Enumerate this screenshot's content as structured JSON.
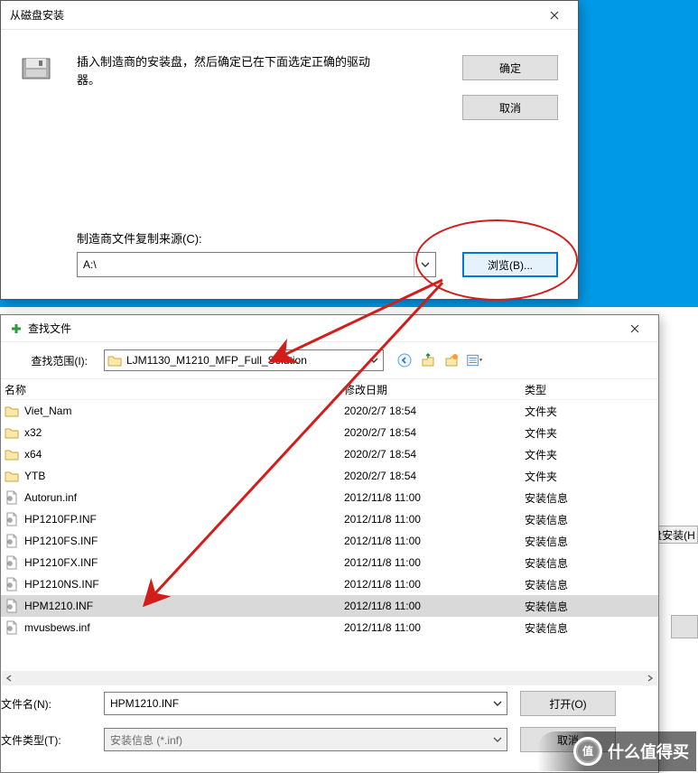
{
  "bg_cut": {
    "text": "盘安装(H"
  },
  "dialog1": {
    "title": "从磁盘安装",
    "instruction": "插入制造商的安装盘，然后确定已在下面选定正确的驱动器。",
    "ok": "确定",
    "cancel": "取消",
    "source_label": "制造商文件复制来源(C):",
    "source_value": "A:\\",
    "browse": "浏览(B)..."
  },
  "dialog2": {
    "title": "查找文件",
    "scope_label": "查找范围(I):",
    "folder_name": "LJM1130_M1210_MFP_Full_Solution",
    "columns": {
      "name": "名称",
      "date": "修改日期",
      "type": "类型"
    },
    "rows": [
      {
        "icon": "folder",
        "name": "Viet_Nam",
        "date": "2020/2/7 18:54",
        "type": "文件夹"
      },
      {
        "icon": "folder",
        "name": "x32",
        "date": "2020/2/7 18:54",
        "type": "文件夹"
      },
      {
        "icon": "folder",
        "name": "x64",
        "date": "2020/2/7 18:54",
        "type": "文件夹"
      },
      {
        "icon": "folder",
        "name": "YTB",
        "date": "2020/2/7 18:54",
        "type": "文件夹"
      },
      {
        "icon": "file",
        "name": "Autorun.inf",
        "date": "2012/11/8 11:00",
        "type": "安装信息"
      },
      {
        "icon": "file",
        "name": "HP1210FP.INF",
        "date": "2012/11/8 11:00",
        "type": "安装信息"
      },
      {
        "icon": "file",
        "name": "HP1210FS.INF",
        "date": "2012/11/8 11:00",
        "type": "安装信息"
      },
      {
        "icon": "file",
        "name": "HP1210FX.INF",
        "date": "2012/11/8 11:00",
        "type": "安装信息"
      },
      {
        "icon": "file",
        "name": "HP1210NS.INF",
        "date": "2012/11/8 11:00",
        "type": "安装信息"
      },
      {
        "icon": "file",
        "name": "HPM1210.INF",
        "date": "2012/11/8 11:00",
        "type": "安装信息",
        "selected": true
      },
      {
        "icon": "file",
        "name": "mvusbews.inf",
        "date": "2012/11/8 11:00",
        "type": "安装信息"
      }
    ],
    "filename_label": "文件名(N):",
    "filename_value": "HPM1210.INF",
    "filetype_label": "文件类型(T):",
    "filetype_value": "安装信息 (*.inf)",
    "open": "打开(O)",
    "cancel2": "取消"
  },
  "watermark": {
    "text": "什么值得买"
  }
}
